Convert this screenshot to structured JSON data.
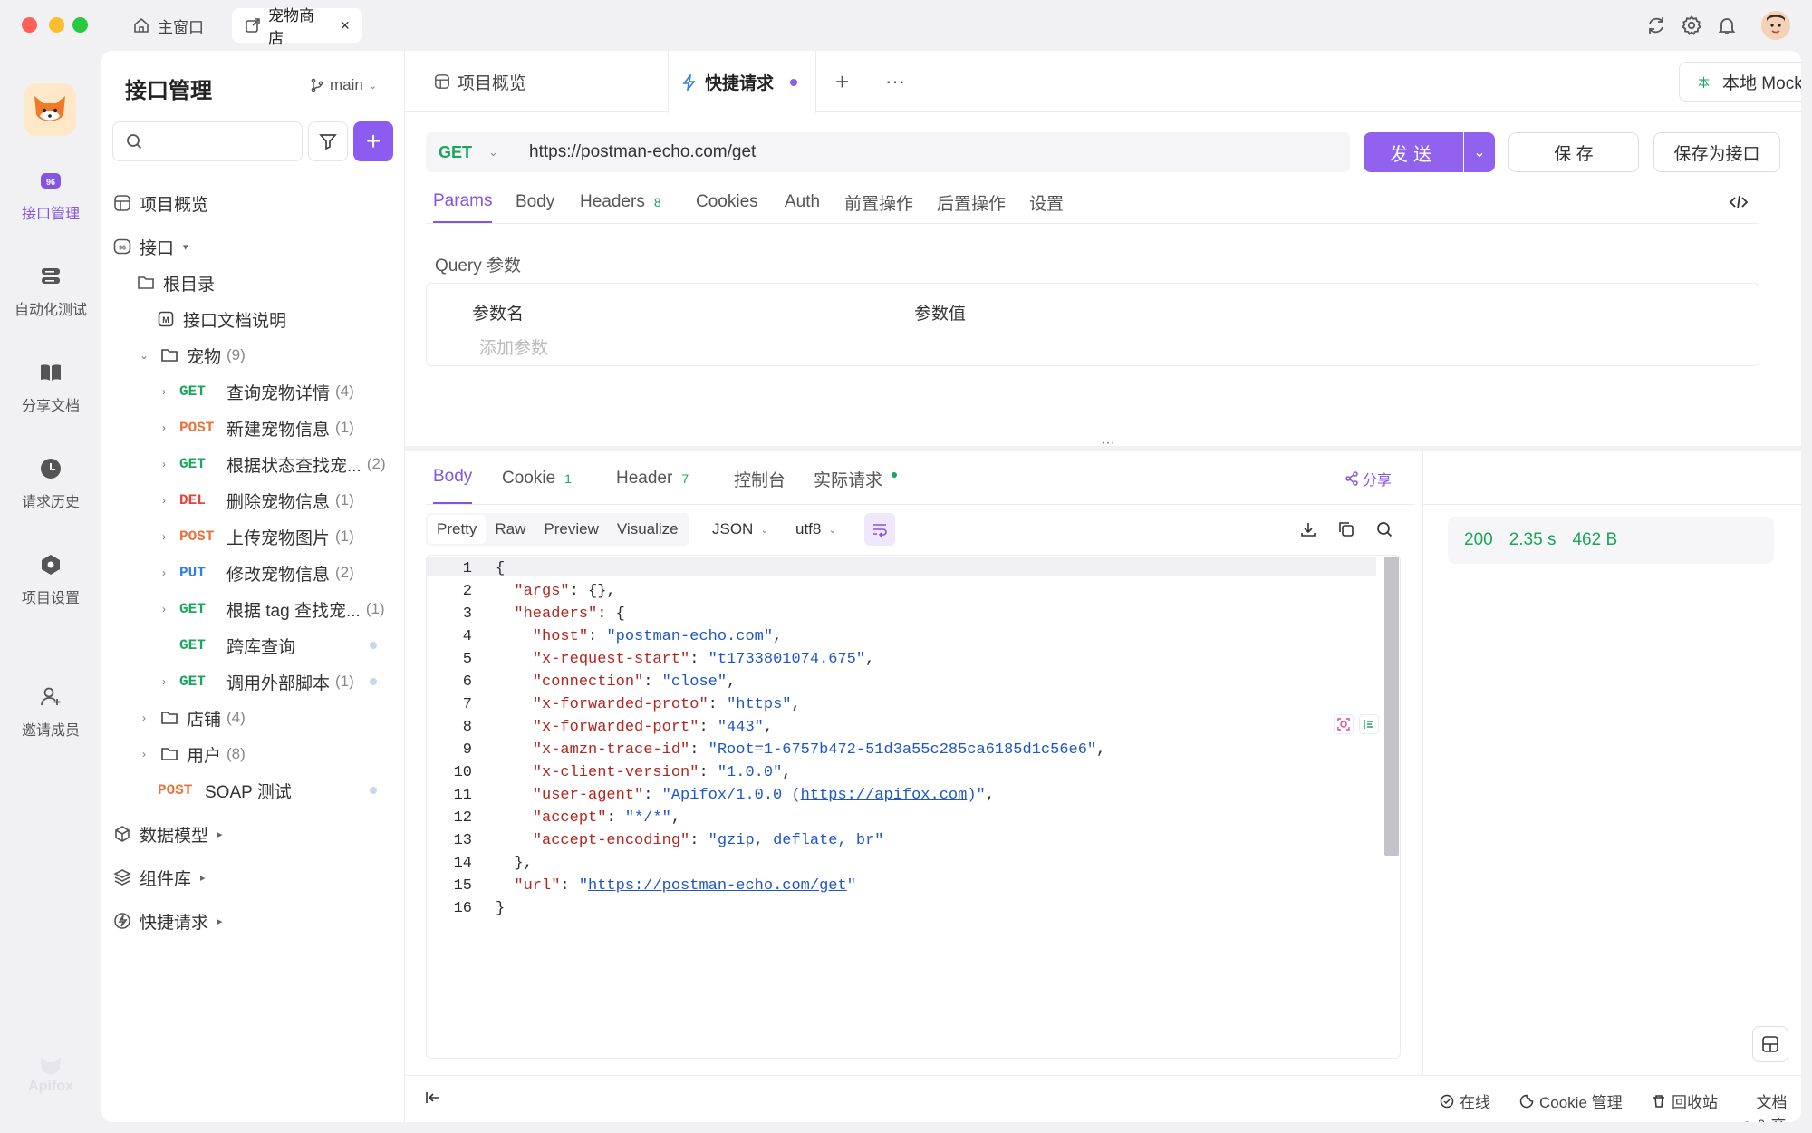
{
  "window": {
    "tabs": [
      {
        "label": "主窗口"
      },
      {
        "label": "宠物商店"
      }
    ]
  },
  "rail": {
    "items": [
      {
        "label": "接口管理"
      },
      {
        "label": "自动化测试"
      },
      {
        "label": "分享文档"
      },
      {
        "label": "请求历史"
      },
      {
        "label": "项目设置"
      },
      {
        "label": "邀请成员"
      }
    ],
    "brand": "Apifox"
  },
  "sidebar": {
    "title": "接口管理",
    "branch": "main",
    "overview": "项目概览",
    "interfaces": "接口",
    "root": "根目录",
    "doc": "接口文档说明",
    "folder_pets": {
      "label": "宠物",
      "count": "(9)"
    },
    "endpoints": [
      {
        "method": "GET",
        "label": "查询宠物详情",
        "count": "(4)"
      },
      {
        "method": "POST",
        "label": "新建宠物信息",
        "count": "(1)"
      },
      {
        "method": "GET",
        "label": "根据状态查找宠...",
        "count": "(2)"
      },
      {
        "method": "DEL",
        "label": "删除宠物信息",
        "count": "(1)"
      },
      {
        "method": "POST",
        "label": "上传宠物图片",
        "count": "(1)"
      },
      {
        "method": "PUT",
        "label": "修改宠物信息",
        "count": "(2)"
      },
      {
        "method": "GET",
        "label": "根据 tag 查找宠...",
        "count": "(1)"
      },
      {
        "method": "GET",
        "label": "跨库查询",
        "count": ""
      },
      {
        "method": "GET",
        "label": "调用外部脚本",
        "count": "(1)"
      }
    ],
    "folder_shop": {
      "label": "店铺",
      "count": "(4)"
    },
    "folder_user": {
      "label": "用户",
      "count": "(8)"
    },
    "soap": {
      "method": "POST",
      "label": "SOAP 测试"
    },
    "models": "数据模型",
    "components": "组件库",
    "quick": "快捷请求"
  },
  "main": {
    "tabs": [
      {
        "label": "项目概览"
      },
      {
        "label": "快捷请求"
      }
    ],
    "env": "本地 Mock",
    "env_short": "本",
    "request": {
      "method": "GET",
      "url": "https://postman-echo.com/get",
      "send": "发送",
      "save": "保 存",
      "save_as": "保存为接口"
    },
    "req_tabs": [
      {
        "label": "Params"
      },
      {
        "label": "Body"
      },
      {
        "label": "Headers",
        "badge": "8"
      },
      {
        "label": "Cookies"
      },
      {
        "label": "Auth"
      },
      {
        "label": "前置操作"
      },
      {
        "label": "后置操作"
      },
      {
        "label": "设置"
      }
    ],
    "query": {
      "title": "Query 参数",
      "col_name": "参数名",
      "col_value": "参数值",
      "placeholder": "添加参数"
    },
    "resp_tabs": [
      {
        "label": "Body"
      },
      {
        "label": "Cookie",
        "badge": "1"
      },
      {
        "label": "Header",
        "badge": "7"
      },
      {
        "label": "控制台"
      },
      {
        "label": "实际请求"
      }
    ],
    "share": "分享",
    "formats": [
      "Pretty",
      "Raw",
      "Preview",
      "Visualize"
    ],
    "lang": "JSON",
    "encoding": "utf8",
    "status": {
      "code": "200",
      "time": "2.35 s",
      "size": "462 B"
    },
    "code_lines": [
      "{",
      "  \"args\": {},",
      "  \"headers\": {",
      "    \"host\": \"postman-echo.com\",",
      "    \"x-request-start\": \"t1733801074.675\",",
      "    \"connection\": \"close\",",
      "    \"x-forwarded-proto\": \"https\",",
      "    \"x-forwarded-port\": \"443\",",
      "    \"x-amzn-trace-id\": \"Root=1-6757b472-51d3a55c285ca6185d1c56e6\",",
      "    \"x-client-version\": \"1.0.0\",",
      "    \"user-agent\": \"Apifox/1.0.0 (https://apifox.com)\",",
      "    \"accept\": \"*/*\",",
      "    \"accept-encoding\": \"gzip, deflate, br\"",
      "  },",
      "  \"url\": \"https://postman-echo.com/get\"",
      "}"
    ]
  },
  "footer": {
    "online": "在线",
    "cookie": "Cookie 管理",
    "trash": "回收站",
    "docs": "文档 & 交流群"
  }
}
